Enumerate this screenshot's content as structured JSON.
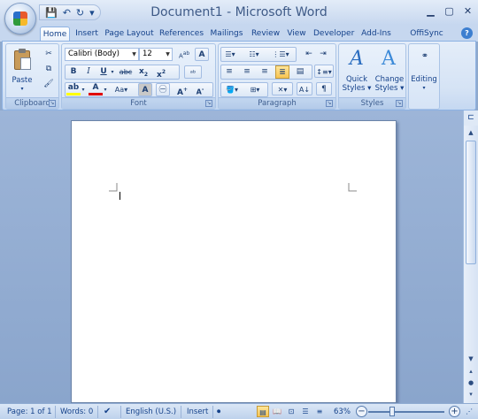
{
  "window": {
    "title": "Document1 - Microsoft Word"
  },
  "qat": {
    "save": "💾",
    "undo": "↶",
    "redo": "↻",
    "more": "▾"
  },
  "tabs": [
    "Home",
    "Insert",
    "Page Layout",
    "References",
    "Mailings",
    "Review",
    "View",
    "Developer",
    "Add-Ins",
    "OffiSync (Beta)"
  ],
  "ribbon": {
    "clipboard": {
      "label": "Clipboard",
      "paste": "Paste"
    },
    "font": {
      "label": "Font",
      "font_name": "Calibri (Body)",
      "font_size": "12"
    },
    "paragraph": {
      "label": "Paragraph"
    },
    "styles": {
      "label": "Styles",
      "quick": "Quick\nStyles",
      "quick_l1": "Quick",
      "quick_l2": "Styles",
      "change_l1": "Change",
      "change_l2": "Styles"
    },
    "editing": {
      "label": "Editing"
    }
  },
  "status": {
    "page": "Page: 1 of 1",
    "words": "Words: 0",
    "language": "English (U.S.)",
    "mode": "Insert",
    "zoom": "63%"
  },
  "colors": {
    "accent": "#15428b",
    "ribbon_bg": "#d5e3f5",
    "workspace": "#8fa9cd"
  }
}
